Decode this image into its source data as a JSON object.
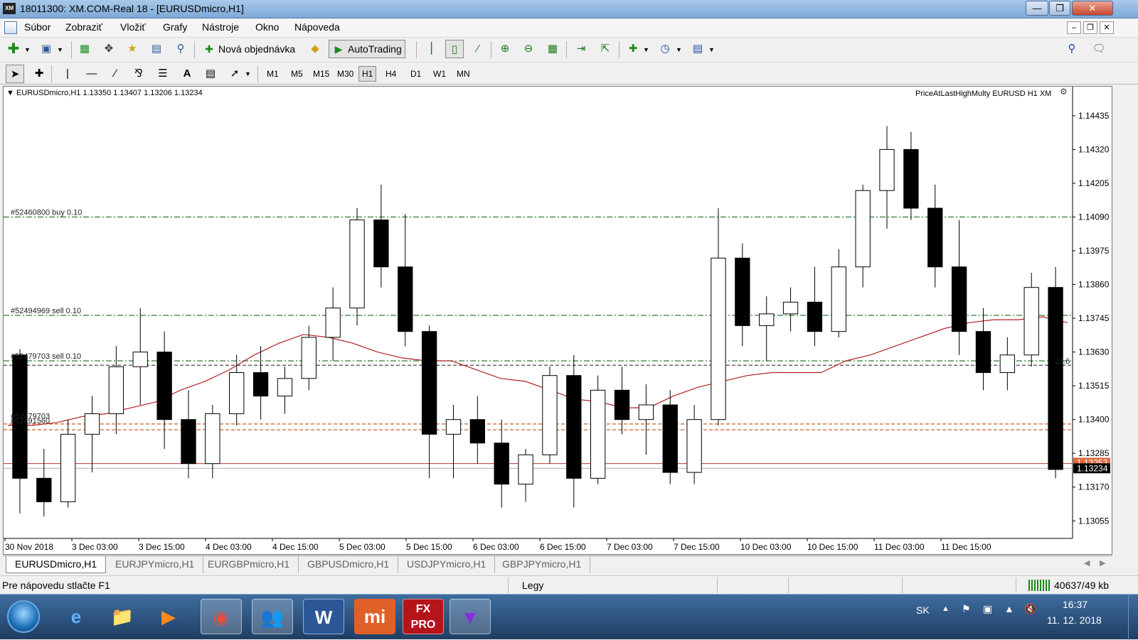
{
  "window": {
    "title": "18011300: XM.COM-Real 18 - [EURUSDmicro,H1]",
    "logo": "XM"
  },
  "menu": [
    "Súbor",
    "Zobraziť",
    "Vložiť",
    "Grafy",
    "Nástroje",
    "Okno",
    "Nápoveda"
  ],
  "toolbar": {
    "new_order_label": "Nová objednávka",
    "autotrading_label": "AutoTrading"
  },
  "timeframes": [
    "M1",
    "M5",
    "M15",
    "M30",
    "H1",
    "H4",
    "D1",
    "W1",
    "MN"
  ],
  "active_timeframe": "H1",
  "chart": {
    "header": "EURUSDmicro,H1  1.13350 1.13407 1.13206 1.13234",
    "indicator_label": "PriceAtLastHighMulty EURUSD H1 XM",
    "order_labels": [
      "#52460800 buy 0.10",
      "#52494969 sell 0.10",
      "#52479703 sell 0.10",
      "#52479703",
      "#52491560"
    ],
    "fib_label": "23.6",
    "current_price": "1.13234",
    "bid_price": "1.13253"
  },
  "chart_data": {
    "type": "candlestick",
    "symbol": "EURUSDmicro",
    "timeframe": "H1",
    "y_ticks": [
      "1.14435",
      "1.14320",
      "1.14205",
      "1.14090",
      "1.13975",
      "1.13860",
      "1.13745",
      "1.13630",
      "1.13515",
      "1.13400",
      "1.13285",
      "1.13170",
      "1.13055"
    ],
    "ylim": [
      1.13,
      1.145
    ],
    "x_ticks": [
      "30 Nov 2018",
      "3 Dec 03:00",
      "3 Dec 15:00",
      "4 Dec 03:00",
      "4 Dec 15:00",
      "5 Dec 03:00",
      "5 Dec 15:00",
      "6 Dec 03:00",
      "6 Dec 15:00",
      "7 Dec 03:00",
      "7 Dec 15:00",
      "10 Dec 03:00",
      "10 Dec 15:00",
      "11 Dec 03:00",
      "11 Dec 15:00"
    ],
    "horizontal_lines": [
      {
        "price": 1.1409,
        "style": "dash-dot",
        "color": "#2f7d32",
        "label": "#52460800 buy 0.10"
      },
      {
        "price": 1.13755,
        "style": "dash-dot",
        "color": "#1b6e1b",
        "label": "#52494969 sell 0.10"
      },
      {
        "price": 1.136,
        "style": "dash-dot",
        "color": "#2f7d32",
        "label": "#52479703 sell 0.10"
      },
      {
        "price": 1.13585,
        "style": "dashed",
        "color": "#333333"
      },
      {
        "price": 1.13385,
        "style": "dashed",
        "color": "#c8602a"
      },
      {
        "price": 1.13365,
        "style": "dashed",
        "color": "#c8602a"
      },
      {
        "price": 1.1325,
        "style": "solid",
        "color": "#c0392b"
      },
      {
        "price": 1.13234,
        "style": "solid",
        "color": "#aaaaaa"
      }
    ],
    "moving_average": [
      1.1338,
      1.1338,
      1.1339,
      1.1341,
      1.1342,
      1.1344,
      1.1346,
      1.135,
      1.1353,
      1.1357,
      1.1362,
      1.1366,
      1.1369,
      1.1368,
      1.1366,
      1.1363,
      1.1361,
      1.136,
      1.136,
      1.1357,
      1.1354,
      1.1353,
      1.135,
      1.1347,
      1.1346,
      1.1344,
      1.1344,
      1.1348,
      1.1351,
      1.1353,
      1.1355,
      1.1356,
      1.1356,
      1.1356,
      1.136,
      1.1362,
      1.1365,
      1.1368,
      1.1371,
      1.1373,
      1.1374,
      1.1374,
      1.1375,
      1.1373
    ],
    "candles": [
      [
        1.1362,
        1.1364,
        1.1308,
        1.132
      ],
      [
        1.132,
        1.133,
        1.1307,
        1.1312
      ],
      [
        1.1312,
        1.134,
        1.131,
        1.1335
      ],
      [
        1.1335,
        1.1348,
        1.1322,
        1.1342
      ],
      [
        1.1342,
        1.1365,
        1.1335,
        1.1358
      ],
      [
        1.1358,
        1.1378,
        1.1345,
        1.1363
      ],
      [
        1.1363,
        1.137,
        1.133,
        1.134
      ],
      [
        1.134,
        1.135,
        1.132,
        1.1325
      ],
      [
        1.1325,
        1.1345,
        1.132,
        1.1342
      ],
      [
        1.1342,
        1.1362,
        1.1338,
        1.1356
      ],
      [
        1.1356,
        1.1365,
        1.134,
        1.1348
      ],
      [
        1.1348,
        1.1358,
        1.1342,
        1.1354
      ],
      [
        1.1354,
        1.1372,
        1.135,
        1.1368
      ],
      [
        1.1368,
        1.1385,
        1.136,
        1.1378
      ],
      [
        1.1378,
        1.1412,
        1.1372,
        1.1408
      ],
      [
        1.1408,
        1.142,
        1.1385,
        1.1392
      ],
      [
        1.1392,
        1.141,
        1.1365,
        1.137
      ],
      [
        1.137,
        1.1372,
        1.132,
        1.1335
      ],
      [
        1.1335,
        1.1345,
        1.132,
        1.134
      ],
      [
        1.134,
        1.1348,
        1.1325,
        1.1332
      ],
      [
        1.1332,
        1.134,
        1.131,
        1.1318
      ],
      [
        1.1318,
        1.133,
        1.1312,
        1.1328
      ],
      [
        1.1328,
        1.1358,
        1.1325,
        1.1355
      ],
      [
        1.1355,
        1.1362,
        1.131,
        1.132
      ],
      [
        1.132,
        1.1355,
        1.1318,
        1.135
      ],
      [
        1.135,
        1.1358,
        1.1335,
        1.134
      ],
      [
        1.134,
        1.1352,
        1.1328,
        1.1345
      ],
      [
        1.1345,
        1.135,
        1.1318,
        1.1322
      ],
      [
        1.1322,
        1.1345,
        1.1318,
        1.134
      ],
      [
        1.134,
        1.1412,
        1.1338,
        1.1395
      ],
      [
        1.1395,
        1.14,
        1.1365,
        1.1372
      ],
      [
        1.1372,
        1.1382,
        1.136,
        1.1376
      ],
      [
        1.1376,
        1.1385,
        1.137,
        1.138
      ],
      [
        1.138,
        1.1392,
        1.1365,
        1.137
      ],
      [
        1.137,
        1.1398,
        1.1368,
        1.1392
      ],
      [
        1.1392,
        1.142,
        1.1385,
        1.1418
      ],
      [
        1.1418,
        1.144,
        1.1405,
        1.1432
      ],
      [
        1.1432,
        1.1438,
        1.1408,
        1.1412
      ],
      [
        1.1412,
        1.142,
        1.1385,
        1.1392
      ],
      [
        1.1392,
        1.1408,
        1.1362,
        1.137
      ],
      [
        1.137,
        1.1378,
        1.135,
        1.1356
      ],
      [
        1.1356,
        1.1368,
        1.135,
        1.1362
      ],
      [
        1.1362,
        1.139,
        1.1358,
        1.1385
      ],
      [
        1.1385,
        1.1392,
        1.132,
        1.1323
      ]
    ]
  },
  "tabs": [
    "EURUSDmicro,H1",
    "EURJPYmicro,H1",
    "EURGBPmicro,H1",
    "GBPUSDmicro,H1",
    "USDJPYmicro,H1",
    "GBPJPYmicro,H1"
  ],
  "active_tab": "EURUSDmicro,H1",
  "status": {
    "help": "Pre nápovedu stlačte F1",
    "profile": "Legy",
    "traffic": "40637/49 kb"
  },
  "taskbar": {
    "lang": "SK",
    "time": "16:37",
    "date": "11. 12. 2018",
    "fxpro_label": "FX PRO",
    "mi_label": "mi"
  }
}
